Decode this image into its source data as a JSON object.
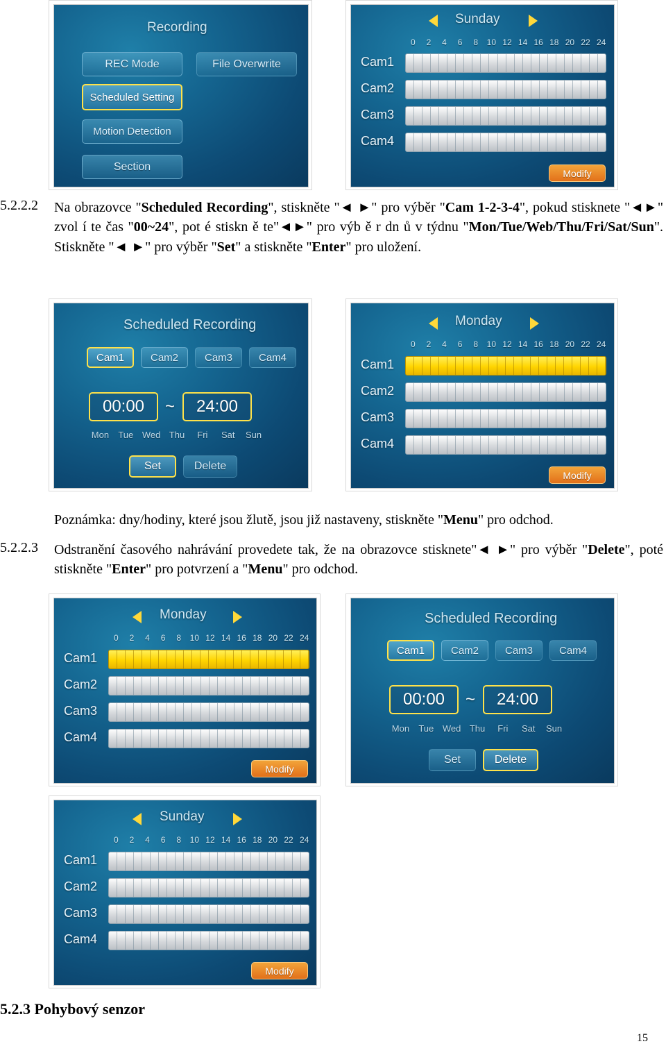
{
  "page": {
    "number": "15"
  },
  "sections": {
    "s1": {
      "num": "5.2.2.2",
      "lead": "5.2.2.2",
      "text_parts": [
        "Na obrazovce \"",
        "Scheduled Recording",
        "\", stiskněte \"",
        "\" pro výběr \"",
        "Cam 1-2-3-4",
        "\", pokud stisknete \"",
        "\" zvol í te čas \"",
        "00~24",
        "\",  pot é   stiskn ě te\"",
        "\" pro výb ě r dn ů  v týdnu \"",
        "Mon/Tue/Web/Thu/Fri/Sat/Sun",
        "\". Stiskněte \"",
        "\" pro výběr \"",
        "Set",
        "\" a stiskněte \"",
        "Enter",
        "\" pro uložení."
      ]
    },
    "note": {
      "text_a": "Poznámka: dny/hodiny, které jsou žlutě, jsou již nastaveny, stiskněte \"",
      "bold": "Menu",
      "text_b": "\" pro odchod."
    },
    "s2": {
      "num": "5.2.2.3",
      "t1": "Odstranění časového nahrávání provedete tak, že na obrazovce stisknete\"",
      "t2": "\" pro výběr \"",
      "b1": "Delete",
      "t3": "\", poté stiskněte \"",
      "b2": "Enter",
      "t4": "\" pro potvrzení a \"",
      "b3": "Menu",
      "t5": "\" pro odchod."
    },
    "s3": {
      "text": "5.2.3 Pohybový senzor"
    }
  },
  "screens": {
    "rec_menu": {
      "title": "Recording",
      "buttons": [
        {
          "label": "REC Mode",
          "selected": false
        },
        {
          "label": "File Overwrite",
          "selected": false
        },
        {
          "label": "Scheduled Setting",
          "selected": true
        },
        {
          "label": "Motion Detection",
          "selected": false
        },
        {
          "label": "Section",
          "selected": false
        }
      ]
    },
    "timeline_sunday_top": {
      "day": "Sunday",
      "ticks": [
        "0",
        "2",
        "4",
        "6",
        "8",
        "10",
        "12",
        "14",
        "16",
        "18",
        "20",
        "22",
        "24"
      ],
      "cams": [
        {
          "label": "Cam1",
          "active": false
        },
        {
          "label": "Cam2",
          "active": false
        },
        {
          "label": "Cam3",
          "active": false
        },
        {
          "label": "Cam4",
          "active": false
        }
      ],
      "modify_label": "Modify"
    },
    "sched_rec_mid": {
      "title": "Scheduled Recording",
      "cams": [
        {
          "label": "Cam1",
          "selected": true
        },
        {
          "label": "Cam2",
          "selected": false
        },
        {
          "label": "Cam3",
          "selected": false
        },
        {
          "label": "Cam4",
          "selected": false
        }
      ],
      "time_start": "00:00",
      "time_sep": "~",
      "time_end": "24:00",
      "days": [
        "Mon",
        "Tue",
        "Wed",
        "Thu",
        "Fri",
        "Sat",
        "Sun"
      ],
      "set_label": "Set",
      "delete_label": "Delete",
      "set_selected": true,
      "delete_selected": false
    },
    "timeline_monday_mid": {
      "day": "Monday",
      "ticks": [
        "0",
        "2",
        "4",
        "6",
        "8",
        "10",
        "12",
        "14",
        "16",
        "18",
        "20",
        "22",
        "24"
      ],
      "cams": [
        {
          "label": "Cam1",
          "active": true
        },
        {
          "label": "Cam2",
          "active": false
        },
        {
          "label": "Cam3",
          "active": false
        },
        {
          "label": "Cam4",
          "active": false
        }
      ],
      "modify_label": "Modify"
    },
    "timeline_monday_low": {
      "day": "Monday",
      "ticks": [
        "0",
        "2",
        "4",
        "6",
        "8",
        "10",
        "12",
        "14",
        "16",
        "18",
        "20",
        "22",
        "24"
      ],
      "cams": [
        {
          "label": "Cam1",
          "active": true
        },
        {
          "label": "Cam2",
          "active": false
        },
        {
          "label": "Cam3",
          "active": false
        },
        {
          "label": "Cam4",
          "active": false
        }
      ],
      "modify_label": "Modify"
    },
    "sched_rec_low": {
      "title": "Scheduled Recording",
      "cams": [
        {
          "label": "Cam1",
          "selected": true
        },
        {
          "label": "Cam2",
          "selected": false
        },
        {
          "label": "Cam3",
          "selected": false
        },
        {
          "label": "Cam4",
          "selected": false
        }
      ],
      "time_start": "00:00",
      "time_sep": "~",
      "time_end": "24:00",
      "days": [
        "Mon",
        "Tue",
        "Wed",
        "Thu",
        "Fri",
        "Sat",
        "Sun"
      ],
      "set_label": "Set",
      "delete_label": "Delete",
      "set_selected": false,
      "delete_selected": true
    },
    "timeline_sunday_bottom": {
      "day": "Sunday",
      "ticks": [
        "0",
        "2",
        "4",
        "6",
        "8",
        "10",
        "12",
        "14",
        "16",
        "18",
        "20",
        "22",
        "24"
      ],
      "cams": [
        {
          "label": "Cam1",
          "active": false
        },
        {
          "label": "Cam2",
          "active": false
        },
        {
          "label": "Cam3",
          "active": false
        },
        {
          "label": "Cam4",
          "active": false
        }
      ],
      "modify_label": "Modify"
    }
  }
}
